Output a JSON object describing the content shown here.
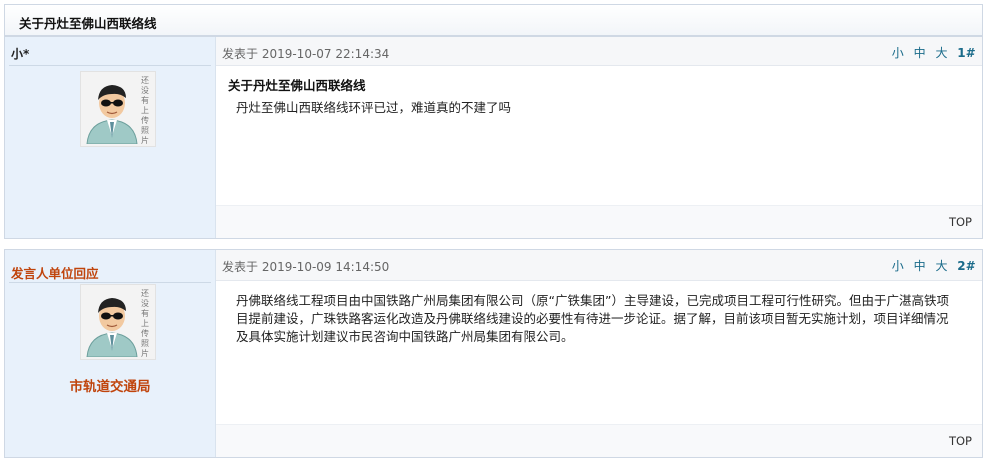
{
  "thread": {
    "title": "关于丹灶至佛山西联络线"
  },
  "posts": [
    {
      "author": "小*",
      "avatar_label": "还没有上传照片",
      "posted": "发表于 2019-10-07 22:14:34",
      "size_small": "小",
      "size_medium": "中",
      "size_large": "大",
      "floor": "1",
      "floor_hash": "#",
      "subject": "关于丹灶至佛山西联络线",
      "body": "丹灶至佛山西联络线环评已过，难道真的不建了吗",
      "top_link": "TOP"
    },
    {
      "author": "发言人单位回应",
      "avatar_label": "还没有上传照片",
      "department": "市轨道交通局",
      "posted": "发表于 2019-10-09 14:14:50",
      "size_small": "小",
      "size_medium": "中",
      "size_large": "大",
      "floor": "2",
      "floor_hash": "#",
      "body": "丹佛联络线工程项目由中国铁路广州局集团有限公司（原“广铁集团”）主导建设，已完成项目工程可行性研究。但由于广湛高铁项目提前建设，广珠铁路客运化改造及丹佛联络线建设的必要性有待进一步论证。据了解，目前该项目暂无实施计划，项目详细情况及具体实施计划建议市民咨询中国铁路广州局集团有限公司。",
      "top_link": "TOP"
    }
  ],
  "icons": {
    "avatar": "default-user-avatar-icon"
  },
  "colors": {
    "author_bg": "#e8f1fb",
    "accent_orange": "#c0440c",
    "floor_green": "#2e8b2e",
    "link_teal": "#1a6b8a"
  }
}
